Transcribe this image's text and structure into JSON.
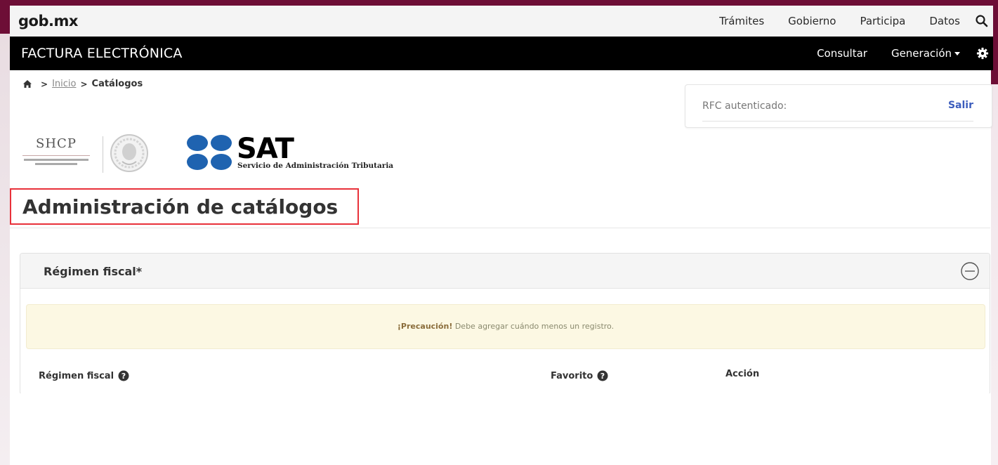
{
  "gob": {
    "logo": "gob.mx",
    "nav": [
      "Trámites",
      "Gobierno",
      "Participa",
      "Datos"
    ]
  },
  "fe": {
    "title": "FACTURA ELECTRÓNICA",
    "consult": "Consultar",
    "generation": "Generación"
  },
  "breadcrumb": {
    "inicio": "Inicio",
    "current": "Catálogos"
  },
  "rfc": {
    "label": "RFC autenticado:",
    "exit": "Salir"
  },
  "logos": {
    "shcp": "SHCP",
    "sat_word": "SAT",
    "sat_sub": "Servicio de Administración Tributaria"
  },
  "page": {
    "title": "Administración de catálogos"
  },
  "panel": {
    "title": "Régimen fiscal*",
    "alert_strong": "¡Precaución!",
    "alert_text": " Debe agregar cuándo menos un registro.",
    "columns": [
      "Régimen fiscal",
      "Favorito",
      "Acción"
    ]
  },
  "colors": {
    "maroon": "#6d0e36",
    "sat_blue": "#1f63b0",
    "alert_bg": "#fcf8e3",
    "link_blue": "#3c5dbd",
    "highlight_red": "#e8313a"
  }
}
